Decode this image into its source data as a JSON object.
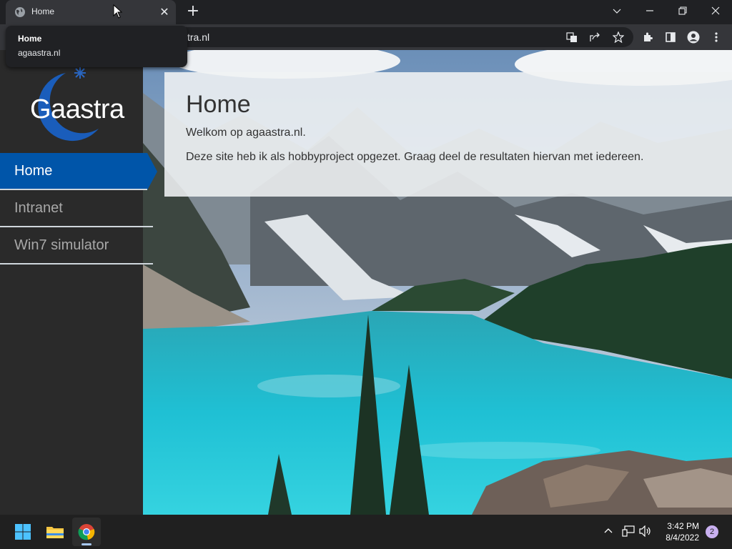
{
  "browser": {
    "tab_title": "Home",
    "tooltip_title": "Home",
    "tooltip_url": "agaastra.nl",
    "url_visible": "tra.nl"
  },
  "site": {
    "logo_text": "Gaastra",
    "nav": [
      {
        "label": "Home"
      },
      {
        "label": "Intranet"
      },
      {
        "label": "Win7 simulator"
      }
    ],
    "heading": "Home",
    "welcome": "Welkom op agaastra.nl.",
    "intro": "Deze site heb ik als hobbyproject opgezet. Graag deel de resultaten hiervan met iedereen."
  },
  "taskbar": {
    "time": "3:42 PM",
    "date": "8/4/2022",
    "notification_count": "2"
  },
  "colors": {
    "accent": "#0055a9",
    "sidebar": "#2a2a2a",
    "chrome": "#35363a"
  },
  "icons": [
    "globe-icon",
    "close-icon",
    "plus-icon",
    "chevron-down-icon",
    "minimize-icon",
    "restore-icon",
    "window-close-icon",
    "translate-icon",
    "share-icon",
    "star-icon",
    "extensions-icon",
    "side-panel-icon",
    "profile-icon",
    "more-icon",
    "windows-start-icon",
    "file-explorer-icon",
    "chrome-icon",
    "chevron-up-icon",
    "network-icon",
    "volume-icon"
  ]
}
